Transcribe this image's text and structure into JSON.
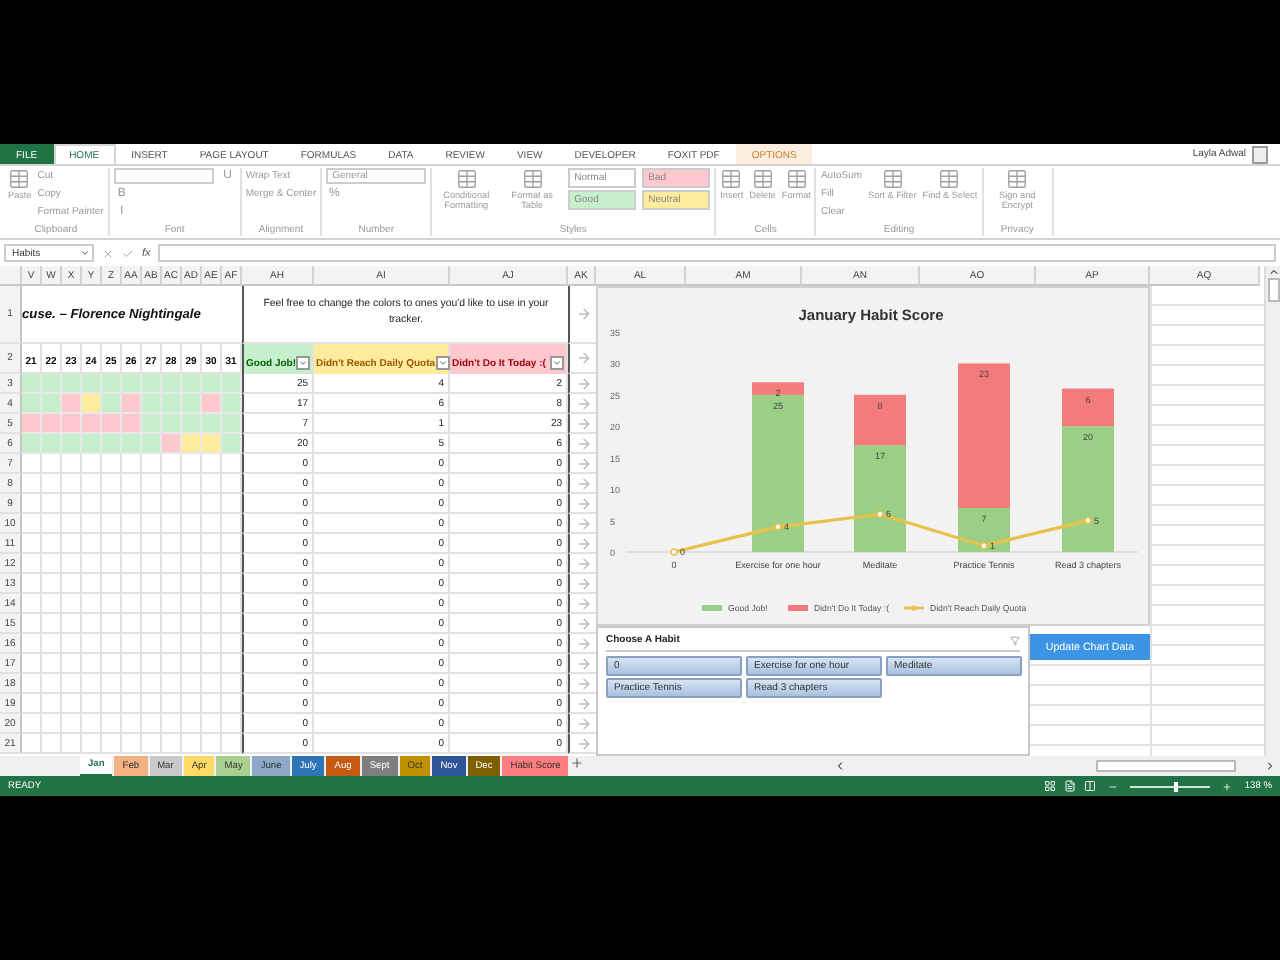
{
  "ribbon": {
    "tabs": [
      {
        "label": "FILE",
        "kind": "file",
        "selected": false
      },
      {
        "label": "HOME",
        "kind": "tab",
        "selected": true
      },
      {
        "label": "INSERT",
        "kind": "tab",
        "selected": false
      },
      {
        "label": "PAGE LAYOUT",
        "kind": "tab",
        "selected": false
      },
      {
        "label": "FORMULAS",
        "kind": "tab",
        "selected": false
      },
      {
        "label": "DATA",
        "kind": "tab",
        "selected": false
      },
      {
        "label": "REVIEW",
        "kind": "tab",
        "selected": false
      },
      {
        "label": "VIEW",
        "kind": "tab",
        "selected": false
      },
      {
        "label": "DEVELOPER",
        "kind": "tab",
        "selected": false
      },
      {
        "label": "FOXIT PDF",
        "kind": "tab",
        "selected": false
      },
      {
        "label": "OPTIONS",
        "kind": "contextual",
        "selected": false
      }
    ],
    "user": "Layla Adwal",
    "groups": [
      {
        "label": "Clipboard",
        "commands": [
          {
            "kind": "large",
            "label": "Paste"
          },
          {
            "kind": "small",
            "label": "Cut"
          },
          {
            "kind": "small",
            "label": "Copy"
          },
          {
            "kind": "small",
            "label": "Format Painter"
          }
        ]
      },
      {
        "label": "Font",
        "commands": [
          {
            "kind": "field"
          },
          {
            "kind": "char",
            "label": "B"
          },
          {
            "kind": "char",
            "label": "I"
          },
          {
            "kind": "char",
            "label": "U"
          }
        ]
      },
      {
        "label": "Alignment",
        "commands": [
          {
            "kind": "small",
            "label": "Wrap Text"
          },
          {
            "kind": "small",
            "label": "Merge & Center"
          }
        ]
      },
      {
        "label": "Number",
        "commands": [
          {
            "kind": "field",
            "label": "General"
          },
          {
            "kind": "char",
            "label": "%"
          }
        ]
      },
      {
        "label": "Styles",
        "commands": [
          {
            "kind": "large",
            "label": "Conditional Formatting"
          },
          {
            "kind": "large",
            "label": "Format as Table"
          },
          {
            "kind": "style",
            "label": "Normal",
            "color": "#ffffff"
          },
          {
            "kind": "style",
            "label": "Good",
            "color": "#c6efce"
          },
          {
            "kind": "style",
            "label": "Bad",
            "color": "#ffc7ce"
          },
          {
            "kind": "style",
            "label": "Neutral",
            "color": "#ffeb9c"
          }
        ]
      },
      {
        "label": "Cells",
        "commands": [
          {
            "kind": "large",
            "label": "Insert"
          },
          {
            "kind": "large",
            "label": "Delete"
          },
          {
            "kind": "large",
            "label": "Format"
          }
        ]
      },
      {
        "label": "Editing",
        "commands": [
          {
            "kind": "small",
            "label": "AutoSum"
          },
          {
            "kind": "small",
            "label": "Fill"
          },
          {
            "kind": "small",
            "label": "Clear"
          },
          {
            "kind": "large",
            "label": "Sort & Filter"
          },
          {
            "kind": "large",
            "label": "Find & Select"
          }
        ]
      },
      {
        "label": "Privacy",
        "commands": [
          {
            "kind": "large",
            "label": "Sign and Encrypt"
          }
        ]
      }
    ]
  },
  "formula_bar": {
    "name_box": "Habits",
    "fx": "fx"
  },
  "sheet": {
    "columns_left": [
      "V",
      "W",
      "X",
      "Y",
      "Z",
      "AA",
      "AB",
      "AC",
      "AD",
      "AE",
      "AF",
      "AH",
      "AI",
      "AJ",
      "AK"
    ],
    "columns_right": [
      "AL",
      "AM",
      "AN",
      "AO",
      "AP",
      "AQ"
    ],
    "quote": "cuse. – Florence Nightingale",
    "note": "Feel free to change the colors to ones you'd like to use in your tracker.",
    "day_headers": [
      "21",
      "22",
      "23",
      "24",
      "25",
      "26",
      "27",
      "28",
      "29",
      "30",
      "31"
    ],
    "headers": [
      {
        "label": "Good Job!",
        "color": "#c6efce"
      },
      {
        "label": "Didn't Reach Daily Quota",
        "color": "#ffeb9c"
      },
      {
        "label": "Didn't Do It Today :(",
        "color": "#ffc7ce"
      }
    ],
    "header_row_numbers": [
      "1",
      "2"
    ],
    "rows": [
      {
        "num": "3",
        "days": [
          {
            "color": "#c6efce"
          },
          {
            "color": "#c6efce"
          },
          {
            "color": "#c6efce"
          },
          {
            "color": "#c6efce"
          },
          {
            "color": "#c6efce"
          },
          {
            "color": "#c6efce"
          },
          {
            "color": "#c6efce"
          },
          {
            "color": "#c6efce"
          },
          {
            "color": "#c6efce"
          },
          {
            "color": "#c6efce"
          },
          {
            "color": "#c6efce"
          }
        ],
        "values": [
          "25",
          "4",
          "2"
        ]
      },
      {
        "num": "4",
        "days": [
          {
            "color": "#c6efce"
          },
          {
            "color": "#c6efce"
          },
          {
            "color": "#ffc7ce"
          },
          {
            "color": "#ffeb9c"
          },
          {
            "color": "#c6efce"
          },
          {
            "color": "#ffc7ce"
          },
          {
            "color": "#c6efce"
          },
          {
            "color": "#c6efce"
          },
          {
            "color": "#c6efce"
          },
          {
            "color": "#ffc7ce"
          },
          {
            "color": "#c6efce"
          }
        ],
        "values": [
          "17",
          "6",
          "8"
        ]
      },
      {
        "num": "5",
        "days": [
          {
            "color": "#ffc7ce"
          },
          {
            "color": "#ffc7ce"
          },
          {
            "color": "#ffc7ce"
          },
          {
            "color": "#ffc7ce"
          },
          {
            "color": "#ffc7ce"
          },
          {
            "color": "#ffc7ce"
          },
          {
            "color": "#c6efce"
          },
          {
            "color": "#c6efce"
          },
          {
            "color": "#c6efce"
          },
          {
            "color": "#c6efce"
          },
          {
            "color": "#c6efce"
          }
        ],
        "values": [
          "7",
          "1",
          "23"
        ]
      },
      {
        "num": "6",
        "days": [
          {
            "color": "#c6efce"
          },
          {
            "color": "#c6efce"
          },
          {
            "color": "#c6efce"
          },
          {
            "color": "#c6efce"
          },
          {
            "color": "#c6efce"
          },
          {
            "color": "#c6efce"
          },
          {
            "color": "#c6efce"
          },
          {
            "color": "#ffc7ce"
          },
          {
            "color": "#ffeb9c"
          },
          {
            "color": "#ffeb9c"
          },
          {
            "color": "#c6efce"
          }
        ],
        "values": [
          "20",
          "5",
          "6"
        ]
      },
      {
        "num": "7",
        "values": [
          "0",
          "0",
          "0"
        ]
      },
      {
        "num": "8",
        "values": [
          "0",
          "0",
          "0"
        ]
      },
      {
        "num": "9",
        "values": [
          "0",
          "0",
          "0"
        ]
      },
      {
        "num": "10",
        "values": [
          "0",
          "0",
          "0"
        ]
      },
      {
        "num": "11",
        "values": [
          "0",
          "0",
          "0"
        ]
      },
      {
        "num": "12",
        "values": [
          "0",
          "0",
          "0"
        ]
      },
      {
        "num": "13",
        "values": [
          "0",
          "0",
          "0"
        ]
      },
      {
        "num": "14",
        "values": [
          "0",
          "0",
          "0"
        ]
      },
      {
        "num": "15",
        "values": [
          "0",
          "0",
          "0"
        ]
      },
      {
        "num": "16",
        "values": [
          "0",
          "0",
          "0"
        ]
      },
      {
        "num": "17",
        "values": [
          "0",
          "0",
          "0"
        ]
      },
      {
        "num": "18",
        "values": [
          "0",
          "0",
          "0"
        ]
      },
      {
        "num": "19",
        "values": [
          "0",
          "0",
          "0"
        ]
      },
      {
        "num": "20",
        "values": [
          "0",
          "0",
          "0"
        ]
      },
      {
        "num": "21",
        "values": [
          "0",
          "0",
          "0"
        ]
      }
    ]
  },
  "chart": {
    "chart_data": {
      "type": "bar",
      "title": "January Habit Score",
      "categories": [
        "0",
        "Exercise for one hour",
        "Meditate",
        "Practice Tennis",
        "Read 3 chapters"
      ],
      "series": [
        {
          "name": "Good Job!",
          "color": "#9bcf86",
          "values": [
            0,
            25,
            17,
            7,
            20
          ],
          "value_labels": [
            null,
            "25",
            "17",
            "7",
            "20"
          ]
        },
        {
          "name": "Didn't Do It Today :(",
          "color": "#f47b7b",
          "values": [
            0,
            2,
            8,
            23,
            6
          ],
          "value_labels": [
            null,
            "2",
            "8",
            "23",
            "6"
          ]
        },
        {
          "name": "Didn't Reach Daily Quota",
          "color": "#e8c14a",
          "values": [
            0,
            4,
            6,
            1,
            5
          ],
          "type": "line",
          "marker": "circle",
          "value_labels": [
            "0",
            "4",
            "6",
            "1",
            "5"
          ]
        }
      ],
      "ylim": [
        0,
        35
      ],
      "yticks": [
        0,
        5,
        10,
        15,
        20,
        25,
        30,
        35
      ],
      "stacked": true,
      "data_labels": true,
      "legend": "bottom"
    }
  },
  "slicer": {
    "title": "Choose A Habit",
    "items": [
      {
        "label": "0",
        "selected": true
      },
      {
        "label": "Exercise for one hour",
        "selected": true
      },
      {
        "label": "Meditate",
        "selected": true
      },
      {
        "label": "Practice Tennis",
        "selected": true
      },
      {
        "label": "Read 3 chapters",
        "selected": true
      }
    ]
  },
  "update_button": "Update Chart Data",
  "sheet_tabs": [
    {
      "label": "Jan",
      "selected": true
    },
    {
      "label": "Feb",
      "color": "#f4b183",
      "selected": false
    },
    {
      "label": "Mar",
      "color": "#c9c9c9",
      "selected": false
    },
    {
      "label": "Apr",
      "color": "#ffd966",
      "selected": false
    },
    {
      "label": "May",
      "color": "#a9d08e",
      "selected": false
    },
    {
      "label": "June",
      "color": "#8ea9c8",
      "selected": false
    },
    {
      "label": "July",
      "color": "#2e75b6",
      "selected": false
    },
    {
      "label": "Aug",
      "color": "#c55a11",
      "selected": false
    },
    {
      "label": "Sept",
      "color": "#7f7f7f",
      "selected": false
    },
    {
      "label": "Oct",
      "color": "#bf9000",
      "selected": false
    },
    {
      "label": "Nov",
      "color": "#2f5597",
      "selected": false
    },
    {
      "label": "Dec",
      "color": "#7f6000",
      "selected": false
    },
    {
      "label": "Habit Score",
      "color": "#ff7c80",
      "selected": false
    }
  ],
  "status_bar": {
    "status": "READY",
    "zoom": {
      "label": "138 %",
      "level": 0.55
    }
  }
}
